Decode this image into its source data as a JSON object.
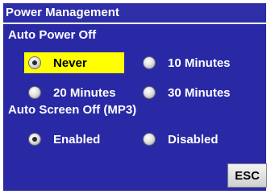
{
  "window": {
    "title": "Power Management"
  },
  "auto_power_off": {
    "label": "Auto Power Off",
    "options": [
      {
        "label": "Never",
        "selected": true
      },
      {
        "label": "10 Minutes",
        "selected": false
      },
      {
        "label": "20 Minutes",
        "selected": false
      },
      {
        "label": "30 Minutes",
        "selected": false
      }
    ]
  },
  "auto_screen_off": {
    "label": "Auto Screen Off (MP3)",
    "options": [
      {
        "label": "Enabled",
        "selected": true
      },
      {
        "label": "Disabled",
        "selected": false
      }
    ]
  },
  "buttons": {
    "esc_label": "ESC"
  },
  "colors": {
    "title_bar": "#2e2ea8",
    "panel": "#2929a6",
    "selection_highlight": "#ffff00",
    "text": "#ffffff"
  }
}
